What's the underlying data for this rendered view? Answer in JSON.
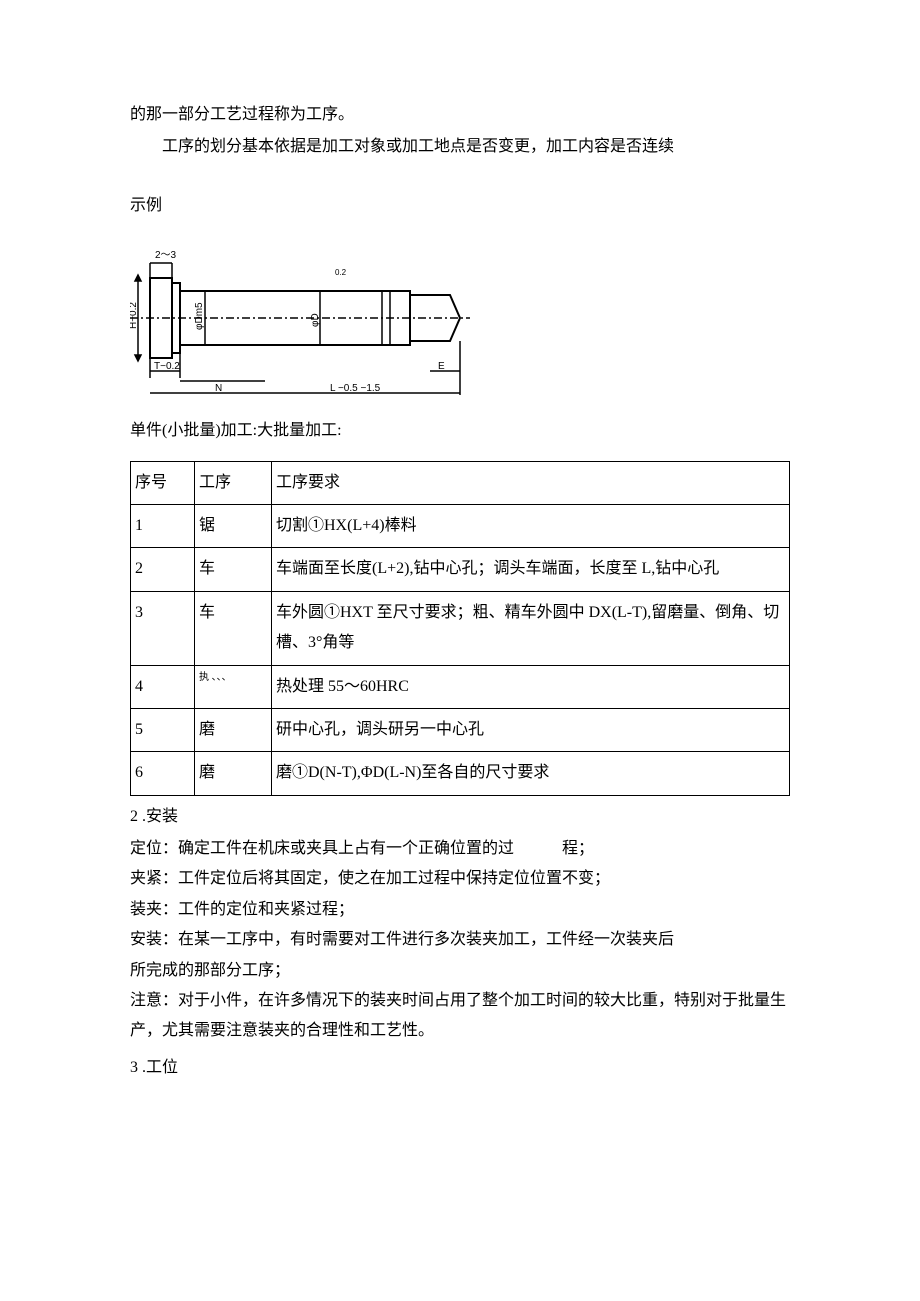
{
  "intro": {
    "l1": "的那一部分工艺过程称为工序。",
    "l2": "工序的划分基本依据是加工对象或加工地点是否变更，加工内容是否连续"
  },
  "diagram_label": "示例",
  "diagram_annotations": {
    "top_dim": "2～3",
    "left_h": "H−0.2",
    "dm5": "φDm5",
    "d": "φD",
    "t": "T−0.2",
    "n": "N",
    "l": "L −0.5 −1.5",
    "e": "E",
    "tol_top": "0.2"
  },
  "batch_line": "单件(小批量)加工:大批量加工:",
  "table": {
    "headers": [
      "序号",
      "工序",
      "工序要求"
    ],
    "rows": [
      {
        "no": "1",
        "step": "锯",
        "req": "切割①HX(L+4)棒料"
      },
      {
        "no": "2",
        "step": "车",
        "req": "车端面至长度(L+2),钻中心孔；调头车端面，长度至 L,钻中心孔"
      },
      {
        "no": "3",
        "step": "车",
        "req": "车外圆①HXT 至尺寸要求；粗、精车外圆中 DX(L-T),留磨量、倒角、切槽、3°角等"
      },
      {
        "no": "4",
        "step_small": "执\n、、、",
        "req": "热处理 55～60HRC"
      },
      {
        "no": "5",
        "step": "磨",
        "req": "研中心孔，调头研另一中心孔"
      },
      {
        "no": "6",
        "step": "磨",
        "req": "磨①D(N-T),ΦD(L-N)至各自的尺寸要求"
      }
    ]
  },
  "sec2_title": "2 .安装",
  "defs": {
    "d1a": "定位：确定工件在机床或夹具上占有一个正确位置的过",
    "d1b": "程；",
    "d2": "夹紧：工件定位后将其固定，使之在加工过程中保持定位位置不变；",
    "d3": "装夹：工件的定位和夹紧过程；",
    "d4": "安装：在某一工序中，有时需要对工件进行多次装夹加工，工件经一次装夹后",
    "d5": "所完成的那部分工序；",
    "d6": "注意：对于小件，在许多情况下的装夹时间占用了整个加工时间的较大比重，特别对于批量生产，尤其需要注意装夹的合理性和工艺性。"
  },
  "sec3_title": "3 .工位"
}
